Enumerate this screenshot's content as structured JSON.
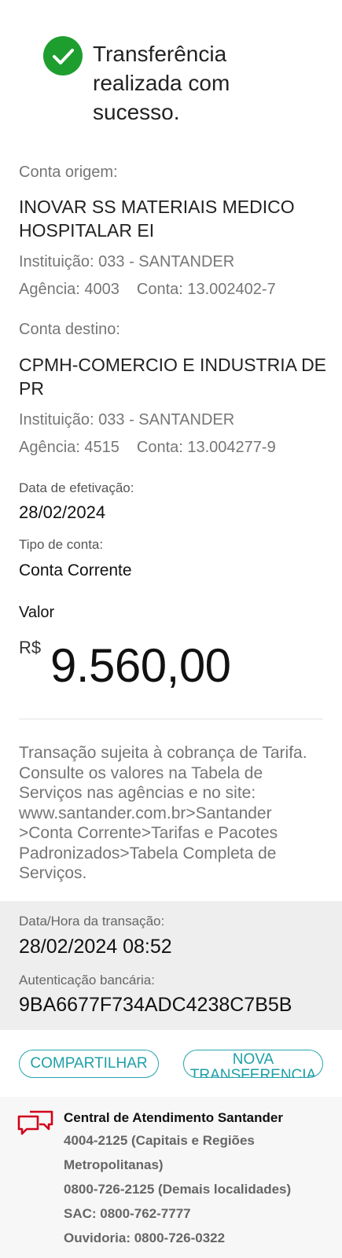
{
  "success": {
    "icon": "check-circle-icon",
    "title": "Transferência realizada com sucesso."
  },
  "origem": {
    "label": "Conta origem:",
    "name": "INOVAR SS MATERIAIS MEDICO HOSPITALAR EI",
    "instituicao": "Instituição: 033 - SANTANDER",
    "agencia": "Agência: 4003",
    "conta": "Conta: 13.002402-7"
  },
  "destino": {
    "label": "Conta destino:",
    "name": "CPMH-COMERCIO E INDUSTRIA DE PR",
    "instituicao": "Instituição: 033 - SANTANDER",
    "agencia": "Agência: 4515",
    "conta": "Conta: 13.004277-9"
  },
  "efetivacao": {
    "label": "Data de efetivação:",
    "value": "28/02/2024"
  },
  "tipo_conta": {
    "label": "Tipo de conta:",
    "value": "Conta Corrente"
  },
  "valor": {
    "label": "Valor",
    "currency": "R$",
    "amount": "9.560,00"
  },
  "disclaimer": "Transação sujeita à cobrança de Tarifa. Consulte os valores na Tabela de Serviços nas agências e no site: www.santander.com.br>Santander >Conta Corrente>Tarifas e Pacotes Padronizados>Tabela Completa de Serviços.",
  "transacao": {
    "datahora_label": "Data/Hora da transação:",
    "datahora_value": "28/02/2024 08:52",
    "auth_label": "Autenticação bancária:",
    "auth_value": "9BA6677F734ADC4238C7B5B"
  },
  "buttons": {
    "share": "COMPARTILHAR",
    "new_transfer": "NOVA TRANSFERENCIA"
  },
  "contact": {
    "icon": "chat-bubbles-icon",
    "title": "Central de Atendimento Santander",
    "lines": [
      "4004-2125 (Capitais e Regiões",
      "Metropolitanas)",
      "0800-726-2125 (Demais localidades)",
      "SAC: 0800-762-7777",
      "Ouvidoria: 0800-726-0322"
    ]
  },
  "colors": {
    "success_green": "#1e9e2e",
    "accent_teal": "#27a3ad",
    "brand_red": "#d0021b"
  }
}
